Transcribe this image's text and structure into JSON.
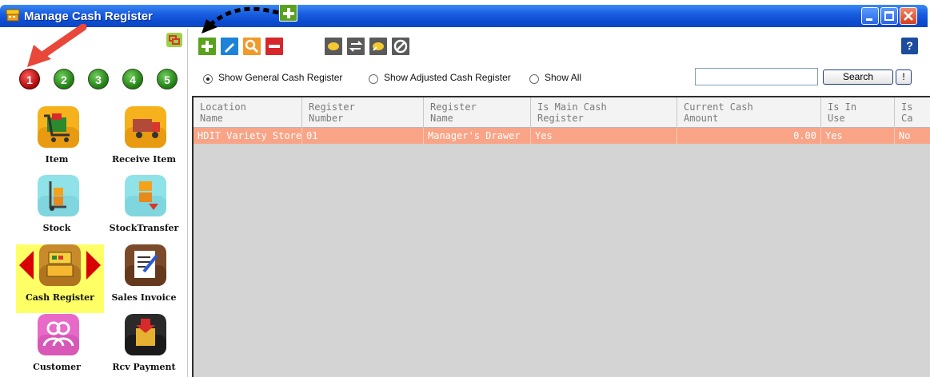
{
  "window": {
    "title": "Manage Cash Register"
  },
  "sidebar": {
    "numbers": [
      "1",
      "2",
      "3",
      "4",
      "5"
    ],
    "active_number": "1",
    "modules": [
      {
        "label": "Item",
        "icon": "shopping-cart-icon"
      },
      {
        "label": "Receive Item",
        "icon": "truck-icon"
      },
      {
        "label": "Stock",
        "icon": "hand-truck-icon"
      },
      {
        "label": "StockTransfer",
        "icon": "box-transfer-icon"
      },
      {
        "label": "Cash Register",
        "icon": "cash-register-icon"
      },
      {
        "label": "Sales Invoice",
        "icon": "invoice-icon"
      },
      {
        "label": "Customer",
        "icon": "customers-icon"
      },
      {
        "label": "Rcv Payment",
        "icon": "payment-icon"
      }
    ],
    "selected_module": "Cash Register"
  },
  "toolbar": {
    "buttons": [
      "add-icon",
      "edit-icon",
      "search-icon",
      "delete-icon",
      "adjust-cash-icon",
      "transfer-icon",
      "cash-out-icon",
      "void-icon"
    ],
    "help_label": "?"
  },
  "filters": {
    "options": [
      "Show General Cash Register",
      "Show Adjusted Cash Register",
      "Show All"
    ],
    "selected": "Show General Cash Register",
    "search_value": "",
    "search_button": "Search",
    "clear_button": "!"
  },
  "grid": {
    "columns": [
      {
        "line1": "Location",
        "line2": "Name"
      },
      {
        "line1": "Register",
        "line2": "Number"
      },
      {
        "line1": "Register",
        "line2": "Name"
      },
      {
        "line1": "Is Main Cash",
        "line2": "Register"
      },
      {
        "line1": "Current Cash",
        "line2": "Amount"
      },
      {
        "line1": "Is In",
        "line2": "Use"
      },
      {
        "line1": "Is",
        "line2": "Ca"
      }
    ],
    "rows": [
      [
        "HDIT Variety Store",
        "01",
        "Manager's Drawer",
        "Yes",
        "0.00",
        "Yes",
        "No"
      ]
    ]
  },
  "colors": {
    "title_bar": "#0b4bd1",
    "selected_row": "#f9a487",
    "highlight": "#ffff66",
    "annotation_red": "#e8473a"
  }
}
